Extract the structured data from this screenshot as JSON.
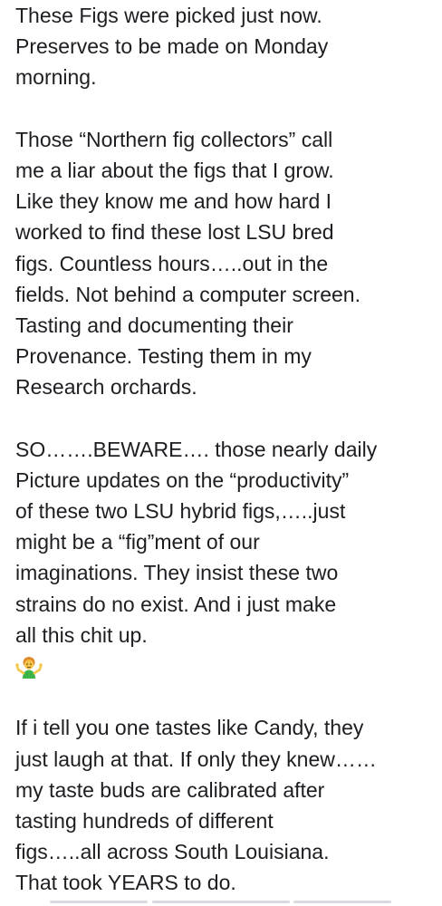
{
  "post": {
    "paragraph_1": [
      "These Figs were picked just now.",
      "Preserves to be made on Monday",
      "morning."
    ],
    "paragraph_2": [
      "Those “Northern fig collectors”  call",
      "me a liar about the figs that I grow.",
      "Like they know me and how hard I",
      "worked to find these lost LSU bred",
      "figs. Countless hours…..out in the",
      "fields. Not behind a computer screen.",
      "Tasting and documenting their",
      "Provenance.  Testing them in my",
      "Research orchards."
    ],
    "paragraph_3": [
      "SO…….BEWARE…. those nearly daily",
      "Picture updates on the “productivity”",
      "of these two LSU hybrid figs,…..just",
      "might be a “fig”ment of our",
      "imaginations.  They insist these two",
      "strains do no exist. And i just make",
      "all this chit up."
    ],
    "emoji": "man-shrugging-icon",
    "paragraph_4": [
      "If i tell you one tastes like Candy, they",
      "just laugh at that. If only they knew……",
      "my taste buds are calibrated after",
      "tasting hundreds of different",
      "figs…..all across South Louisiana.",
      "That took YEARS to do."
    ]
  },
  "colors": {
    "text": "#1c1e21",
    "background": "#ffffff"
  }
}
